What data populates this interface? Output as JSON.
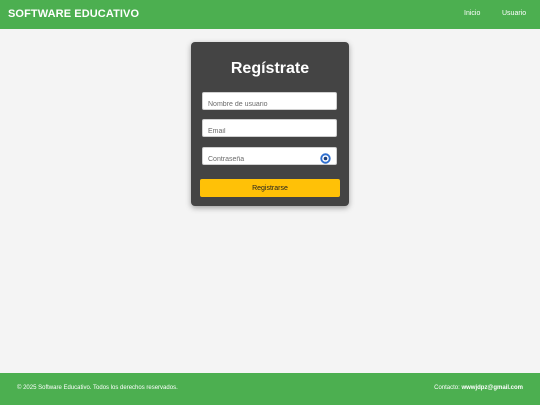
{
  "header": {
    "brand": "SOFTWARE EDUCATIVO",
    "nav": [
      "Inicio",
      "Usuario"
    ]
  },
  "form": {
    "title": "Regístrate",
    "username_placeholder": "Nombre de usuario",
    "email_placeholder": "Email",
    "password_placeholder": "Contraseña",
    "password_toggle_icon": "eye-icon",
    "submit_label": "Registrarse"
  },
  "footer": {
    "copyright": "© 2025 Software Educativo. Todos los derechos reservados.",
    "contact_label": "Contacto:",
    "contact_email": "wwwjdpz@gmail.com"
  },
  "colors": {
    "header_bg": "#4caf50",
    "card_bg": "#444444",
    "button_bg": "#ffc107",
    "page_bg": "#f4f4f4"
  }
}
